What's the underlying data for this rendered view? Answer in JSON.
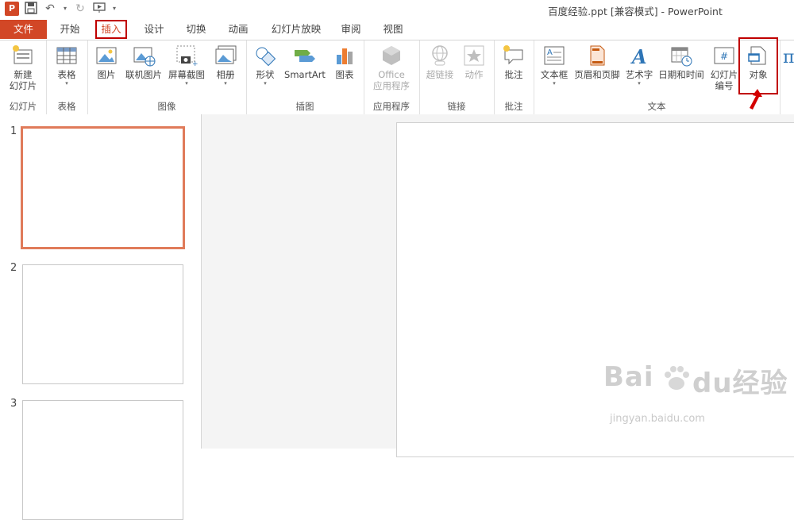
{
  "window": {
    "title": "百度经验.ppt [兼容模式] - PowerPoint"
  },
  "qat": {
    "icons": [
      "powerpoint-logo-icon",
      "save-icon",
      "undo-icon",
      "redo-icon",
      "slideshow-from-start-icon",
      "customize-qat-icon"
    ]
  },
  "tabs": {
    "file": "文件",
    "items": [
      "开始",
      "插入",
      "设计",
      "切换",
      "动画",
      "幻灯片放映",
      "审阅",
      "视图"
    ],
    "active": "插入"
  },
  "ribbon": {
    "groups": {
      "slides": {
        "label": "幻灯片",
        "new_slide_line1": "新建",
        "new_slide_line2": "幻灯片"
      },
      "tables": {
        "label": "表格",
        "table": "表格"
      },
      "images": {
        "label": "图像",
        "picture": "图片",
        "online_picture": "联机图片",
        "screenshot": "屏幕截图",
        "album": "相册"
      },
      "illustrations": {
        "label": "插图",
        "shapes": "形状",
        "smartart": "SmartArt",
        "chart": "图表"
      },
      "apps": {
        "label": "应用程序",
        "office_line1": "Office",
        "office_line2": "应用程序"
      },
      "links": {
        "label": "链接",
        "hyperlink": "超链接",
        "action": "动作"
      },
      "comments": {
        "label": "批注",
        "comment": "批注"
      },
      "text": {
        "label": "文本",
        "textbox": "文本框",
        "header_footer": "页眉和页脚",
        "wordart": "艺术字",
        "datetime": "日期和时间",
        "slide_number_line1": "幻灯片",
        "slide_number_line2": "编号",
        "object": "对象"
      }
    }
  },
  "slides": {
    "numbers": [
      "1",
      "2",
      "3"
    ],
    "selected": "1"
  },
  "watermark": {
    "brand": "Bai",
    "brand_cn": "du经验",
    "url": "jingyan.baidu.com"
  },
  "colors": {
    "accent": "#d24726",
    "highlight": "#c00000",
    "thumb_selected": "#e07b5a"
  }
}
